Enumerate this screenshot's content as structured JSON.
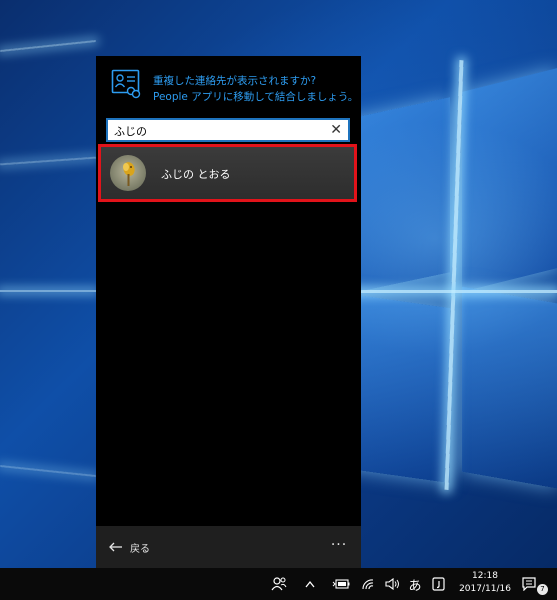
{
  "notice": {
    "line1": "重複した連絡先が表示されますか?",
    "line2": "People アプリに移動して結合しましょう。",
    "icon": "contact-card-link-icon"
  },
  "search": {
    "value": "ふじの",
    "clear_icon": "close-icon"
  },
  "results": [
    {
      "name": "ふじの とおる",
      "avatar": "contact-photo-avatar"
    }
  ],
  "bottom_bar": {
    "back_label": "戻る",
    "more_label": "···"
  },
  "taskbar": {
    "time": "12:18",
    "date": "2017/11/16",
    "ime_label": "あ",
    "notification_count": "7"
  },
  "colors": {
    "accent": "#2d9cf0",
    "highlight": "#e2131a",
    "search_border": "#1e73be"
  }
}
